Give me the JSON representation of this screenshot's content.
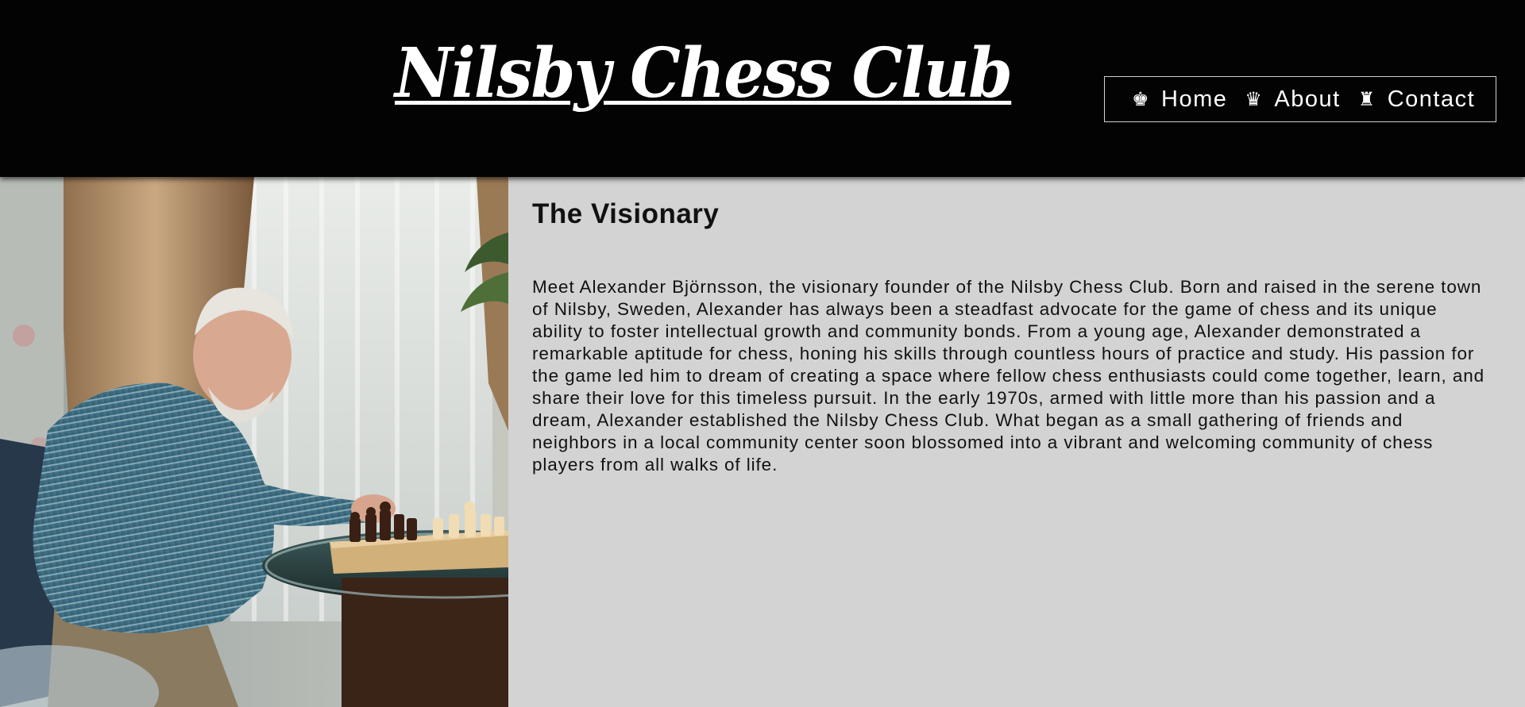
{
  "header": {
    "site_title": "Nilsby Chess Club"
  },
  "nav": {
    "items": [
      {
        "label": "Home",
        "icon": "♚",
        "icon_name": "chess-king-icon"
      },
      {
        "label": "About",
        "icon": "♛",
        "icon_name": "chess-queen-icon"
      },
      {
        "label": "Contact",
        "icon": "♜",
        "icon_name": "chess-rook-icon"
      }
    ]
  },
  "main": {
    "section_title": "The Visionary",
    "bio_text": "Meet Alexander Björnsson, the visionary founder of the Nilsby Chess Club. Born and raised in the serene town of Nilsby, Sweden, Alexander has always been a steadfast advocate for the game of chess and its unique ability to foster intellectual growth and community bonds. From a young age, Alexander demonstrated a remarkable aptitude for chess, honing his skills through countless hours of practice and study. His passion for the game led him to dream of creating a space where fellow chess enthusiasts could come together, learn, and share their love for this timeless pursuit. In the early 1970s, armed with little more than his passion and a dream, Alexander established the Nilsby Chess Club. What began as a small gathering of friends and neighbors in a local community center soon blossomed into a vibrant and welcoming community of chess players from all walks of life."
  },
  "colors": {
    "header_bg": "#030303",
    "page_bg": "#d3d3d3",
    "text": "#111111",
    "nav_border": "#cfcfcf"
  }
}
